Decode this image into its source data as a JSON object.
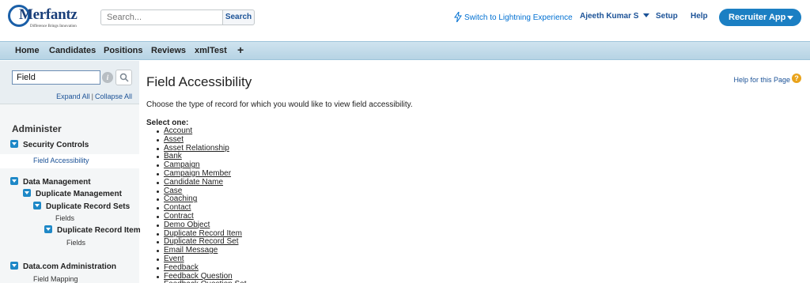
{
  "header": {
    "logo_text": "Merfantz",
    "logo_tagline": "Difference Brings Innovation",
    "search_placeholder": "Search...",
    "search_button": "Search",
    "lightning_link": "Switch to Lightning Experience",
    "user_name": "Ajeeth Kumar S",
    "setup": "Setup",
    "help": "Help",
    "app_menu": "Recruiter App"
  },
  "tabs": [
    "Home",
    "Candidates",
    "Positions",
    "Reviews",
    "xmlTest"
  ],
  "tab_add_label": "+",
  "sidebar": {
    "search_value": "Field",
    "expand_all": "Expand All",
    "separator": "|",
    "collapse_all": "Collapse All",
    "heading": "Administer",
    "security_controls": "Security Controls",
    "field_accessibility": "Field Accessibility",
    "data_management": "Data Management",
    "duplicate_management": "Duplicate Management",
    "duplicate_record_sets": "Duplicate Record Sets",
    "fields_1": "Fields",
    "duplicate_record_items": "Duplicate Record Items",
    "fields_2": "Fields",
    "datacom_admin": "Data.com Administration",
    "field_mapping": "Field Mapping"
  },
  "main": {
    "title": "Field Accessibility",
    "help_for_page": "Help for this Page",
    "description": "Choose the type of record for which you would like to view field accessibility.",
    "select_label": "Select one:",
    "objects": [
      "Account",
      "Asset",
      "Asset Relationship",
      "Bank",
      "Campaign",
      "Campaign Member",
      "Candidate Name",
      "Case",
      "Coaching",
      "Contact",
      "Contract",
      "Demo Object",
      "Duplicate Record Item",
      "Duplicate Record Set",
      "Email Message",
      "Event",
      "Feedback",
      "Feedback Question",
      "Feedback Question Set"
    ]
  },
  "colors": {
    "accent": "#1b7fc3",
    "link": "#1b5297",
    "tabbar": "#b6d3e4",
    "help_icon": "#e9a31b"
  }
}
